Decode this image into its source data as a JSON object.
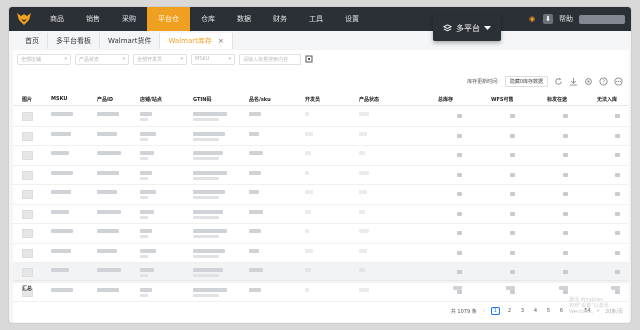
{
  "nav": {
    "items": [
      "商品",
      "销售",
      "采购",
      "平台仓",
      "仓库",
      "数据",
      "财务",
      "工具",
      "设置"
    ],
    "active_index": 3,
    "help_label": "帮助"
  },
  "platform_switch": {
    "label": "多平台"
  },
  "tabs": [
    {
      "label": "首页",
      "active": false
    },
    {
      "label": "多平台看板",
      "active": false
    },
    {
      "label": "Walmart货件",
      "active": false
    },
    {
      "label": "Walmart库存",
      "active": true,
      "close": "×"
    }
  ],
  "filters": {
    "selects": [
      "全部店铺",
      "产品状态",
      "全部开发员",
      "MSKU"
    ],
    "search_placeholder": "请输入批量搜索内容"
  },
  "toolbar": {
    "update_label": "库存更新时间:",
    "hide_zero_label": "隐藏0库存数据"
  },
  "table": {
    "headers": [
      "图片",
      "MSKU",
      "产品ID",
      "店铺/站点",
      "GTIN码",
      "品名/sku",
      "开发员",
      "产品状态",
      "总库存",
      "WFS可售",
      "标发在途",
      "无法入库"
    ],
    "row_count": 10,
    "highlight_row": 8,
    "summary_label": "汇总"
  },
  "pagination": {
    "total_prefix": "共",
    "total": "1079",
    "total_suffix": "条",
    "pages": [
      "1",
      "2",
      "3",
      "4",
      "5",
      "6",
      "...",
      "54"
    ],
    "current": "1",
    "page_size": "20条/页"
  },
  "watermark": {
    "line1": "激活 Windows",
    "line2": "转到\"设置\"以激活 Windows。"
  },
  "colors": {
    "nav_bg": "#2b2f36",
    "accent": "#f0a020",
    "link": "#1677ff"
  },
  "icons": [
    "fox-logo-icon",
    "layers-icon",
    "caret-down-icon",
    "refresh-icon",
    "download-icon",
    "gear-icon",
    "help-circle-icon",
    "more-icon",
    "chevron-left-icon",
    "chevron-right-icon",
    "close-icon",
    "scan-icon"
  ]
}
